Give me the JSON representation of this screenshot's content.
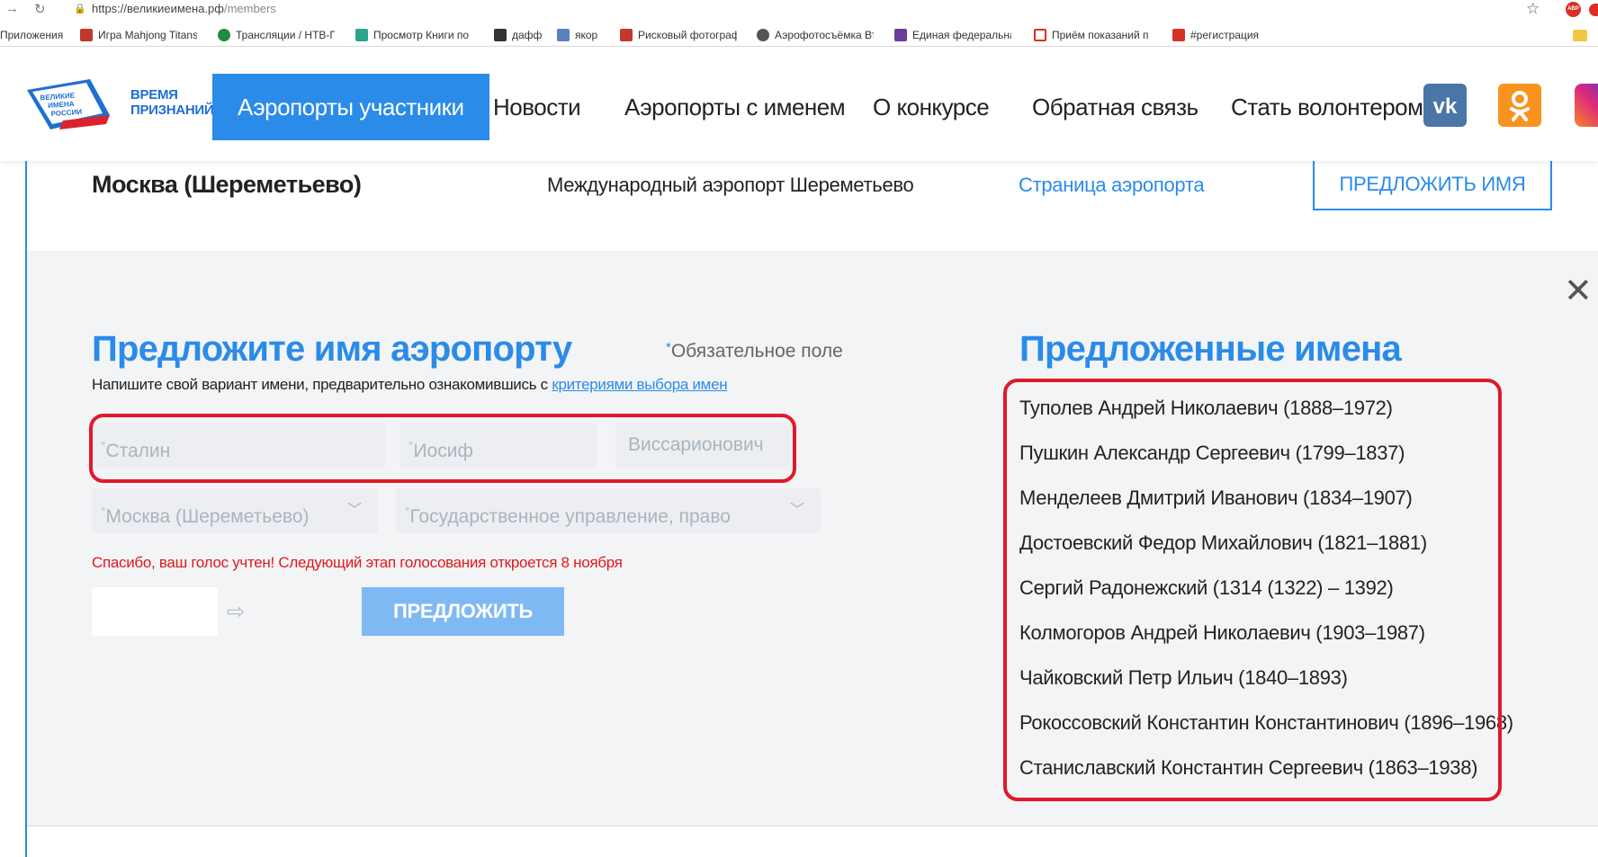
{
  "browser": {
    "url_host": "https://великиеимена.рф",
    "url_path": "/members",
    "bookmarks": [
      {
        "label": "Приложения",
        "color": "#4285f4"
      },
      {
        "label": "Игра Mahjong Titans",
        "color": "#c0392b"
      },
      {
        "label": "Трансляции / НТВ-П",
        "color": "#1e8e3e"
      },
      {
        "label": "Просмотр Книги по",
        "color": "#2ca58d"
      },
      {
        "label": "дафф",
        "color": "#333333"
      },
      {
        "label": "якор",
        "color": "#5b7fbf"
      },
      {
        "label": "Рисковый фотограф",
        "color": "#c0392b"
      },
      {
        "label": "Аэрофотосъёмка Вт",
        "color": "#555555"
      },
      {
        "label": "Единая федеральная",
        "color": "#6a3d9a"
      },
      {
        "label": "Приём показаний п",
        "color": "#d93025"
      },
      {
        "label": "#регистрация",
        "color": "#d93025"
      }
    ],
    "extension_badge": "ABP"
  },
  "header": {
    "logo_text": "ВЕЛИКИЕ ИМЕНА РОССИИ",
    "logo_caption_line1": "ВРЕМЯ",
    "logo_caption_line2": "ПРИЗНАНИЙ!",
    "nav": [
      {
        "label": "Аэропорты участники",
        "active": true
      },
      {
        "label": "Новости"
      },
      {
        "label": "Аэропорты с именем"
      },
      {
        "label": "О конкурсе"
      },
      {
        "label": "Обратная связь"
      },
      {
        "label": "Стать волонтером"
      }
    ],
    "social": [
      "vk-icon",
      "odnoklassniki-icon",
      "instagram-icon"
    ]
  },
  "airport": {
    "city": "Москва (Шереметьево)",
    "full_name": "Международный аэропорт Шереметьево",
    "page_link": "Страница аэропорта",
    "propose_button": "ПРЕДЛОЖИТЬ ИМЯ"
  },
  "form": {
    "title": "Предложите имя аэропорту",
    "required_note": "Обязательное поле",
    "hint": "Напишите свой вариант имени, предварительно ознакомившись с",
    "hint_link": "критериями выбора имен",
    "last_name": "Сталин",
    "first_name": "Иосиф",
    "middle_name": "Виссарионович",
    "airport_select": "Москва (Шереметьево)",
    "category_select": "Государственное управление, право",
    "thanks_message": "Спасибо, ваш голос учтен! Следующий этап голосования откроется 8 ноября",
    "submit_label": "ПРЕДЛОЖИТЬ"
  },
  "suggested": {
    "title": "Предложенные имена",
    "names": [
      "Туполев Андрей Николаевич (1888–1972)",
      "Пушкин Александр Сергеевич (1799–1837)",
      "Менделеев Дмитрий Иванович (1834–1907)",
      "Достоевский Федор Михайлович (1821–1881)",
      "Сергий Радонежский (1314 (1322) – 1392)",
      "Колмогоров Андрей Николаевич (1903–1987)",
      "Чайковский Петр Ильич (1840–1893)",
      "Рокоссовский Константин Константинович (1896–1968)",
      "Станиславский Константин Сергеевич (1863–1938)"
    ]
  },
  "colors": {
    "accent": "#2b8be8",
    "annotation": "#e0192b",
    "thanks": "#e0191b"
  }
}
